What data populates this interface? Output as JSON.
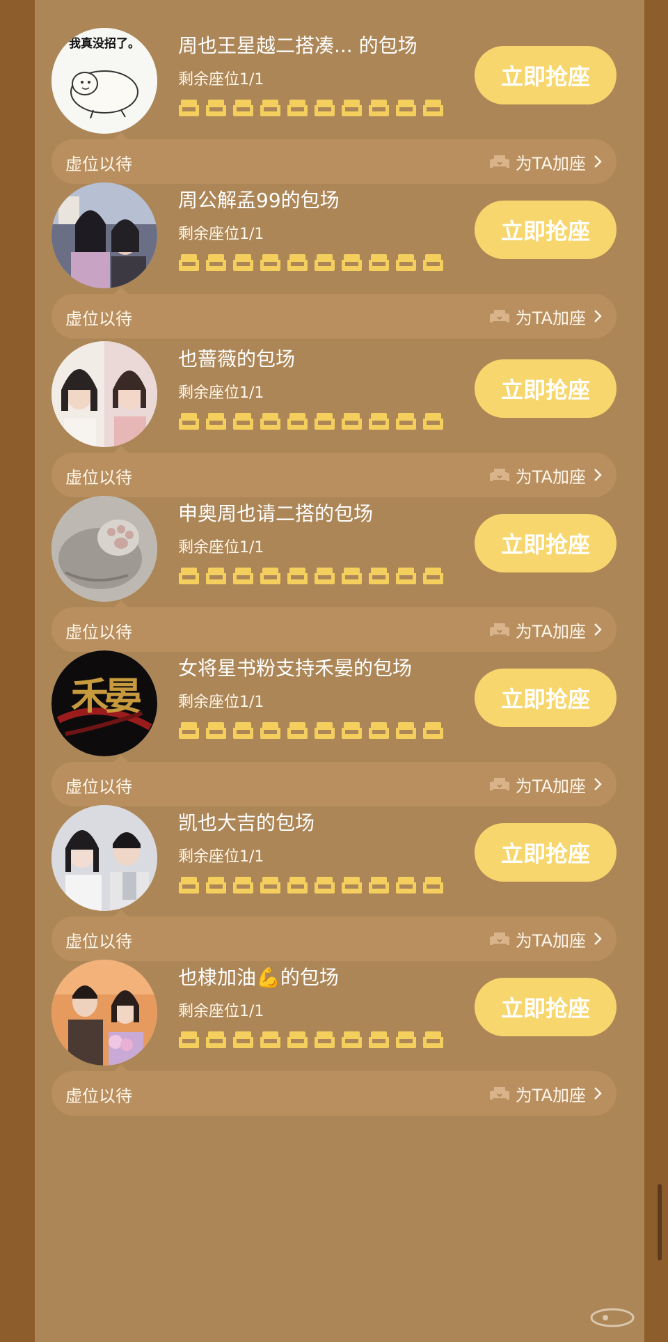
{
  "colors": {
    "page_background": "#8e5d2c",
    "panel_background": "#ac8657",
    "bar_background": "#b98f5f",
    "button_background": "#f7d66d",
    "seat_icon": "#f4cf5e",
    "text_primary": "#ffffff"
  },
  "icons": {
    "seat": "sofa-seat-icon",
    "add_seat": "sofa-icon",
    "chevron": "chevron-right-icon"
  },
  "seats_per_row": 10,
  "sessions": [
    {
      "title": "周也王星越二搭凑... 的包场",
      "remaining": "剩余座位1/1",
      "button": "立即抢座",
      "waiting": "虚位以待",
      "add_seat": "为TA加座",
      "avatar": {
        "type": "meme-seal",
        "caption": "我真没招了。"
      }
    },
    {
      "title": "周公解孟99的包场",
      "remaining": "剩余座位1/1",
      "button": "立即抢座",
      "waiting": "虚位以待",
      "add_seat": "为TA加座",
      "avatar": {
        "type": "photo-two-people"
      }
    },
    {
      "title": "也蔷薇的包场",
      "remaining": "剩余座位1/1",
      "button": "立即抢座",
      "waiting": "虚位以待",
      "add_seat": "为TA加座",
      "avatar": {
        "type": "photo-two-portraits"
      }
    },
    {
      "title": "申奥周也请二搭的包场",
      "remaining": "剩余座位1/1",
      "button": "立即抢座",
      "waiting": "虚位以待",
      "add_seat": "为TA加座",
      "avatar": {
        "type": "photo-cat-paw"
      }
    },
    {
      "title": "女将星书粉支持禾晏的包场",
      "remaining": "剩余座位1/1",
      "button": "立即抢座",
      "waiting": "虚位以待",
      "add_seat": "为TA加座",
      "avatar": {
        "type": "calligraphy-logo",
        "caption": "禾晏"
      }
    },
    {
      "title": "凯也大吉的包场",
      "remaining": "剩余座位1/1",
      "button": "立即抢座",
      "waiting": "虚位以待",
      "add_seat": "为TA加座",
      "avatar": {
        "type": "photo-two-people"
      }
    },
    {
      "title": "也棣加油💪的包场",
      "remaining": "剩余座位1/1",
      "button": "立即抢座",
      "waiting": "虚位以待",
      "add_seat": "为TA加座",
      "avatar": {
        "type": "photo-two-people-warm"
      }
    }
  ]
}
